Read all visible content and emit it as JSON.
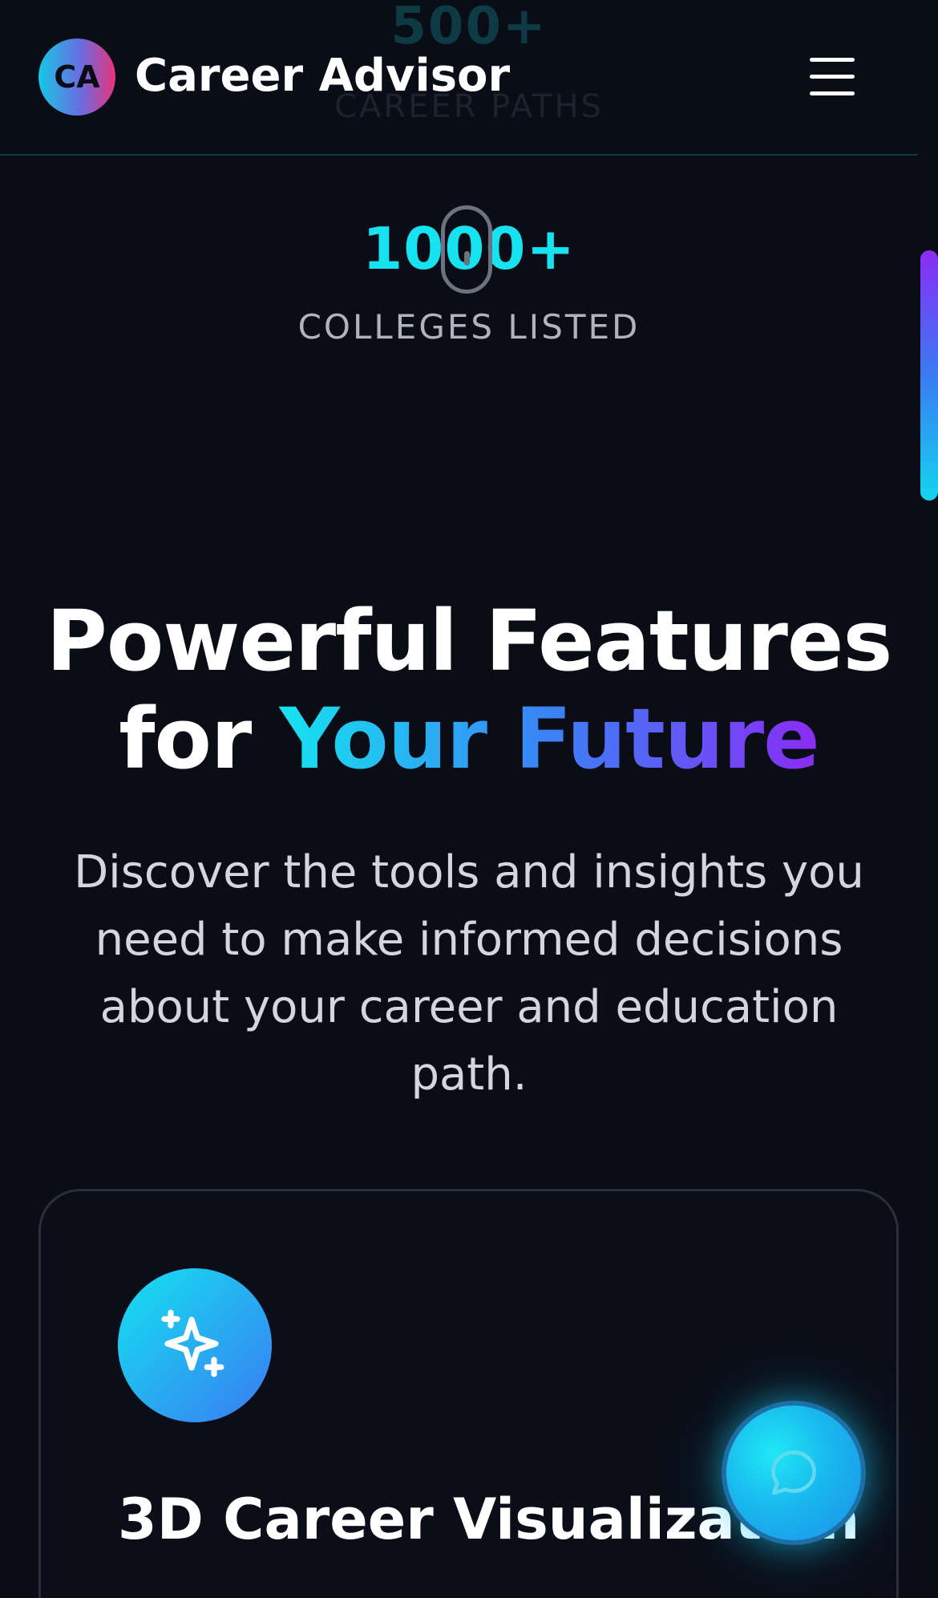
{
  "header": {
    "logo_text": "CA",
    "brand": "Career Advisor",
    "menu_icon": "hamburger-menu-icon"
  },
  "stats": [
    {
      "value": "500+",
      "label": "CAREER PATHS"
    },
    {
      "value": "1000+",
      "label": "COLLEGES LISTED"
    }
  ],
  "features_section": {
    "title_line1": "Powerful Features",
    "title_for": "for ",
    "title_highlight": "Your Future",
    "description": "Discover the tools and insights you need to make informed decisions about your career and education path."
  },
  "feature_cards": [
    {
      "icon": "sparkles-icon",
      "title": "3D Career Visualization"
    }
  ],
  "chat": {
    "icon": "chat-bubble-icon"
  },
  "colors": {
    "background": "#0a0d16",
    "accent_cyan": "#16e3ef",
    "accent_blue": "#3b82f6",
    "accent_purple": "#8a2cf5",
    "logo_pink": "#e6347d"
  }
}
